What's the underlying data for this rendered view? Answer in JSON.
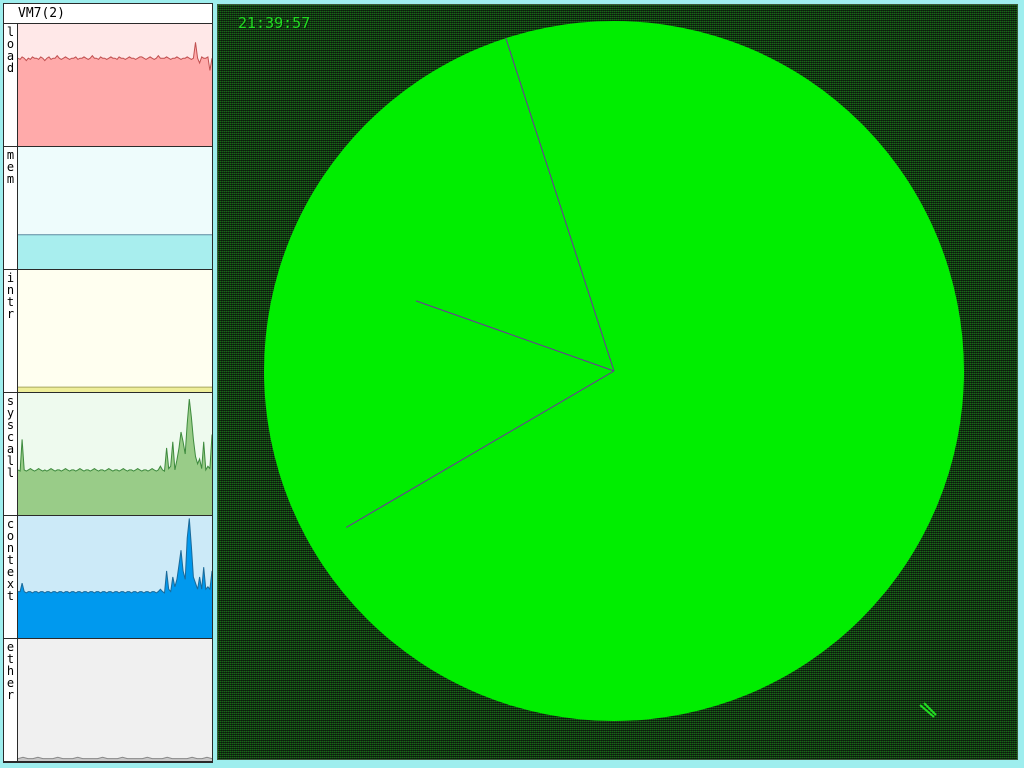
{
  "stats": {
    "title": "VM7(2)",
    "panels": [
      {
        "id": "load",
        "label": "load",
        "fill": "#ffaaaa",
        "bg": "#ffe8e8",
        "line": "#c05050",
        "values": [
          0.72,
          0.71,
          0.73,
          0.72,
          0.7,
          0.72,
          0.71,
          0.73,
          0.72,
          0.72,
          0.71,
          0.73,
          0.72,
          0.7,
          0.72,
          0.73,
          0.71,
          0.72,
          0.72,
          0.74,
          0.72,
          0.71,
          0.72,
          0.73,
          0.72,
          0.71,
          0.72,
          0.72,
          0.73,
          0.71,
          0.72,
          0.72,
          0.73,
          0.72,
          0.71,
          0.72,
          0.74,
          0.72,
          0.72,
          0.71,
          0.73,
          0.72,
          0.72,
          0.71,
          0.72,
          0.73,
          0.72,
          0.72,
          0.71,
          0.73,
          0.72,
          0.72,
          0.71,
          0.72,
          0.73,
          0.72,
          0.72,
          0.71,
          0.72,
          0.73,
          0.73,
          0.72,
          0.71,
          0.72,
          0.73,
          0.72,
          0.71,
          0.72,
          0.74,
          0.72,
          0.72,
          0.72,
          0.73,
          0.72,
          0.71,
          0.72,
          0.72,
          0.73,
          0.72,
          0.71,
          0.72,
          0.72,
          0.73,
          0.72,
          0.71,
          0.72,
          0.85,
          0.72,
          0.68,
          0.73,
          0.72,
          0.72,
          0.73,
          0.62,
          0.72
        ]
      },
      {
        "id": "mem",
        "label": "mem",
        "fill": "#a8eeee",
        "bg": "#eefcfc",
        "line": "#5a8aa0",
        "values": [
          0.28,
          0.28,
          0.28,
          0.28,
          0.28,
          0.28,
          0.28,
          0.28,
          0.28,
          0.28,
          0.28,
          0.28,
          0.28,
          0.28,
          0.28,
          0.28,
          0.28,
          0.28,
          0.28,
          0.28,
          0.28,
          0.28,
          0.28,
          0.28,
          0.28,
          0.28,
          0.28,
          0.28,
          0.28,
          0.28,
          0.28,
          0.28,
          0.28,
          0.28,
          0.28,
          0.28,
          0.28,
          0.28,
          0.28,
          0.28
        ]
      },
      {
        "id": "intr",
        "label": "intr",
        "fill": "#eeee99",
        "bg": "#fffff0",
        "line": "#a8a860",
        "values": [
          0.04,
          0.04,
          0.04,
          0.04,
          0.04,
          0.04,
          0.04,
          0.04,
          0.04,
          0.04,
          0.04,
          0.04,
          0.04,
          0.04,
          0.04,
          0.04,
          0.04,
          0.04,
          0.04,
          0.04,
          0.04,
          0.04,
          0.04,
          0.04,
          0.04,
          0.04,
          0.04,
          0.04,
          0.04,
          0.04,
          0.04,
          0.04,
          0.04,
          0.04,
          0.04,
          0.04,
          0.04,
          0.04,
          0.04,
          0.04
        ]
      },
      {
        "id": "syscall",
        "label": "syscall",
        "fill": "#99cc88",
        "bg": "#eefaee",
        "line": "#3d8a3d",
        "values": [
          0.37,
          0.36,
          0.62,
          0.37,
          0.36,
          0.37,
          0.38,
          0.37,
          0.36,
          0.37,
          0.38,
          0.37,
          0.36,
          0.37,
          0.36,
          0.37,
          0.38,
          0.37,
          0.36,
          0.37,
          0.37,
          0.36,
          0.37,
          0.38,
          0.37,
          0.36,
          0.37,
          0.37,
          0.36,
          0.37,
          0.38,
          0.37,
          0.36,
          0.37,
          0.37,
          0.36,
          0.37,
          0.38,
          0.37,
          0.36,
          0.37,
          0.37,
          0.36,
          0.37,
          0.38,
          0.37,
          0.36,
          0.37,
          0.37,
          0.36,
          0.37,
          0.38,
          0.37,
          0.36,
          0.37,
          0.37,
          0.36,
          0.37,
          0.38,
          0.37,
          0.36,
          0.37,
          0.37,
          0.36,
          0.37,
          0.38,
          0.37,
          0.36,
          0.37,
          0.4,
          0.37,
          0.36,
          0.55,
          0.38,
          0.4,
          0.6,
          0.37,
          0.45,
          0.55,
          0.68,
          0.6,
          0.5,
          0.75,
          0.95,
          0.8,
          0.62,
          0.48,
          0.42,
          0.46,
          0.38,
          0.6,
          0.37,
          0.4,
          0.38,
          0.66
        ]
      },
      {
        "id": "context",
        "label": "context",
        "fill": "#0099ee",
        "bg": "#cceaf8",
        "line": "#1a6a9a",
        "values": [
          0.38,
          0.38,
          0.45,
          0.38,
          0.37,
          0.38,
          0.38,
          0.37,
          0.38,
          0.38,
          0.37,
          0.38,
          0.38,
          0.37,
          0.38,
          0.38,
          0.37,
          0.38,
          0.38,
          0.37,
          0.38,
          0.38,
          0.37,
          0.38,
          0.38,
          0.37,
          0.38,
          0.38,
          0.37,
          0.38,
          0.38,
          0.37,
          0.38,
          0.38,
          0.37,
          0.38,
          0.38,
          0.37,
          0.38,
          0.38,
          0.37,
          0.38,
          0.38,
          0.37,
          0.38,
          0.38,
          0.37,
          0.38,
          0.38,
          0.37,
          0.38,
          0.38,
          0.37,
          0.38,
          0.38,
          0.37,
          0.38,
          0.38,
          0.37,
          0.38,
          0.38,
          0.37,
          0.38,
          0.38,
          0.37,
          0.38,
          0.38,
          0.37,
          0.38,
          0.4,
          0.38,
          0.37,
          0.55,
          0.4,
          0.38,
          0.5,
          0.42,
          0.48,
          0.6,
          0.72,
          0.55,
          0.48,
          0.82,
          0.98,
          0.75,
          0.5,
          0.45,
          0.4,
          0.5,
          0.4,
          0.58,
          0.4,
          0.42,
          0.4,
          0.55
        ]
      },
      {
        "id": "ether",
        "label": "ether",
        "fill": "#c8c8c8",
        "bg": "#f0f0f0",
        "line": "#888888",
        "values": [
          0.02,
          0.03,
          0.02,
          0.02,
          0.03,
          0.02,
          0.02,
          0.02,
          0.03,
          0.02,
          0.02,
          0.02,
          0.03,
          0.02,
          0.02,
          0.02,
          0.02,
          0.03,
          0.02,
          0.02,
          0.02,
          0.03,
          0.02,
          0.02,
          0.02,
          0.02,
          0.03,
          0.02,
          0.02,
          0.02,
          0.03,
          0.02,
          0.02,
          0.02,
          0.02,
          0.03,
          0.02,
          0.02,
          0.03,
          0.02
        ]
      }
    ]
  },
  "clock": {
    "time": "21:39:57",
    "hours": 21,
    "minutes": 39,
    "seconds": 57,
    "face_color": "#00ee00",
    "hand_color": "#7030a0"
  }
}
